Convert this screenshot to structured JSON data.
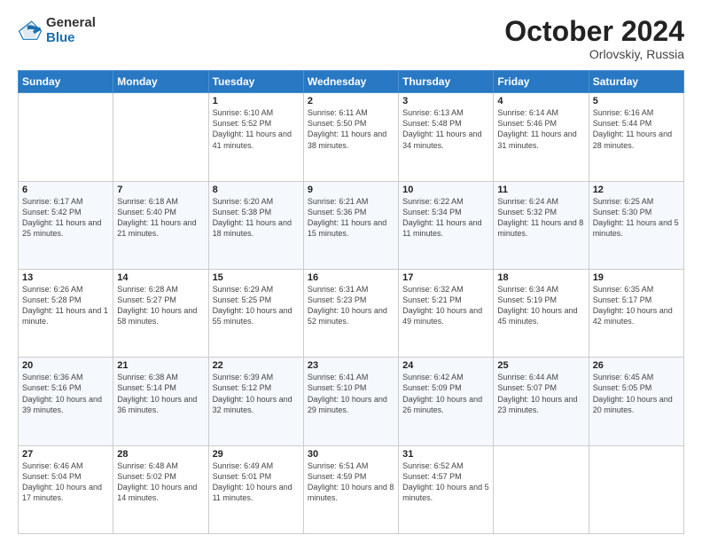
{
  "header": {
    "logo_general": "General",
    "logo_blue": "Blue",
    "month_title": "October 2024",
    "location": "Orlovskiy, Russia"
  },
  "days_of_week": [
    "Sunday",
    "Monday",
    "Tuesday",
    "Wednesday",
    "Thursday",
    "Friday",
    "Saturday"
  ],
  "weeks": [
    [
      {
        "day": "",
        "sunrise": "",
        "sunset": "",
        "daylight": ""
      },
      {
        "day": "",
        "sunrise": "",
        "sunset": "",
        "daylight": ""
      },
      {
        "day": "1",
        "sunrise": "Sunrise: 6:10 AM",
        "sunset": "Sunset: 5:52 PM",
        "daylight": "Daylight: 11 hours and 41 minutes."
      },
      {
        "day": "2",
        "sunrise": "Sunrise: 6:11 AM",
        "sunset": "Sunset: 5:50 PM",
        "daylight": "Daylight: 11 hours and 38 minutes."
      },
      {
        "day": "3",
        "sunrise": "Sunrise: 6:13 AM",
        "sunset": "Sunset: 5:48 PM",
        "daylight": "Daylight: 11 hours and 34 minutes."
      },
      {
        "day": "4",
        "sunrise": "Sunrise: 6:14 AM",
        "sunset": "Sunset: 5:46 PM",
        "daylight": "Daylight: 11 hours and 31 minutes."
      },
      {
        "day": "5",
        "sunrise": "Sunrise: 6:16 AM",
        "sunset": "Sunset: 5:44 PM",
        "daylight": "Daylight: 11 hours and 28 minutes."
      }
    ],
    [
      {
        "day": "6",
        "sunrise": "Sunrise: 6:17 AM",
        "sunset": "Sunset: 5:42 PM",
        "daylight": "Daylight: 11 hours and 25 minutes."
      },
      {
        "day": "7",
        "sunrise": "Sunrise: 6:18 AM",
        "sunset": "Sunset: 5:40 PM",
        "daylight": "Daylight: 11 hours and 21 minutes."
      },
      {
        "day": "8",
        "sunrise": "Sunrise: 6:20 AM",
        "sunset": "Sunset: 5:38 PM",
        "daylight": "Daylight: 11 hours and 18 minutes."
      },
      {
        "day": "9",
        "sunrise": "Sunrise: 6:21 AM",
        "sunset": "Sunset: 5:36 PM",
        "daylight": "Daylight: 11 hours and 15 minutes."
      },
      {
        "day": "10",
        "sunrise": "Sunrise: 6:22 AM",
        "sunset": "Sunset: 5:34 PM",
        "daylight": "Daylight: 11 hours and 11 minutes."
      },
      {
        "day": "11",
        "sunrise": "Sunrise: 6:24 AM",
        "sunset": "Sunset: 5:32 PM",
        "daylight": "Daylight: 11 hours and 8 minutes."
      },
      {
        "day": "12",
        "sunrise": "Sunrise: 6:25 AM",
        "sunset": "Sunset: 5:30 PM",
        "daylight": "Daylight: 11 hours and 5 minutes."
      }
    ],
    [
      {
        "day": "13",
        "sunrise": "Sunrise: 6:26 AM",
        "sunset": "Sunset: 5:28 PM",
        "daylight": "Daylight: 11 hours and 1 minute."
      },
      {
        "day": "14",
        "sunrise": "Sunrise: 6:28 AM",
        "sunset": "Sunset: 5:27 PM",
        "daylight": "Daylight: 10 hours and 58 minutes."
      },
      {
        "day": "15",
        "sunrise": "Sunrise: 6:29 AM",
        "sunset": "Sunset: 5:25 PM",
        "daylight": "Daylight: 10 hours and 55 minutes."
      },
      {
        "day": "16",
        "sunrise": "Sunrise: 6:31 AM",
        "sunset": "Sunset: 5:23 PM",
        "daylight": "Daylight: 10 hours and 52 minutes."
      },
      {
        "day": "17",
        "sunrise": "Sunrise: 6:32 AM",
        "sunset": "Sunset: 5:21 PM",
        "daylight": "Daylight: 10 hours and 49 minutes."
      },
      {
        "day": "18",
        "sunrise": "Sunrise: 6:34 AM",
        "sunset": "Sunset: 5:19 PM",
        "daylight": "Daylight: 10 hours and 45 minutes."
      },
      {
        "day": "19",
        "sunrise": "Sunrise: 6:35 AM",
        "sunset": "Sunset: 5:17 PM",
        "daylight": "Daylight: 10 hours and 42 minutes."
      }
    ],
    [
      {
        "day": "20",
        "sunrise": "Sunrise: 6:36 AM",
        "sunset": "Sunset: 5:16 PM",
        "daylight": "Daylight: 10 hours and 39 minutes."
      },
      {
        "day": "21",
        "sunrise": "Sunrise: 6:38 AM",
        "sunset": "Sunset: 5:14 PM",
        "daylight": "Daylight: 10 hours and 36 minutes."
      },
      {
        "day": "22",
        "sunrise": "Sunrise: 6:39 AM",
        "sunset": "Sunset: 5:12 PM",
        "daylight": "Daylight: 10 hours and 32 minutes."
      },
      {
        "day": "23",
        "sunrise": "Sunrise: 6:41 AM",
        "sunset": "Sunset: 5:10 PM",
        "daylight": "Daylight: 10 hours and 29 minutes."
      },
      {
        "day": "24",
        "sunrise": "Sunrise: 6:42 AM",
        "sunset": "Sunset: 5:09 PM",
        "daylight": "Daylight: 10 hours and 26 minutes."
      },
      {
        "day": "25",
        "sunrise": "Sunrise: 6:44 AM",
        "sunset": "Sunset: 5:07 PM",
        "daylight": "Daylight: 10 hours and 23 minutes."
      },
      {
        "day": "26",
        "sunrise": "Sunrise: 6:45 AM",
        "sunset": "Sunset: 5:05 PM",
        "daylight": "Daylight: 10 hours and 20 minutes."
      }
    ],
    [
      {
        "day": "27",
        "sunrise": "Sunrise: 6:46 AM",
        "sunset": "Sunset: 5:04 PM",
        "daylight": "Daylight: 10 hours and 17 minutes."
      },
      {
        "day": "28",
        "sunrise": "Sunrise: 6:48 AM",
        "sunset": "Sunset: 5:02 PM",
        "daylight": "Daylight: 10 hours and 14 minutes."
      },
      {
        "day": "29",
        "sunrise": "Sunrise: 6:49 AM",
        "sunset": "Sunset: 5:01 PM",
        "daylight": "Daylight: 10 hours and 11 minutes."
      },
      {
        "day": "30",
        "sunrise": "Sunrise: 6:51 AM",
        "sunset": "Sunset: 4:59 PM",
        "daylight": "Daylight: 10 hours and 8 minutes."
      },
      {
        "day": "31",
        "sunrise": "Sunrise: 6:52 AM",
        "sunset": "Sunset: 4:57 PM",
        "daylight": "Daylight: 10 hours and 5 minutes."
      },
      {
        "day": "",
        "sunrise": "",
        "sunset": "",
        "daylight": ""
      },
      {
        "day": "",
        "sunrise": "",
        "sunset": "",
        "daylight": ""
      }
    ]
  ]
}
